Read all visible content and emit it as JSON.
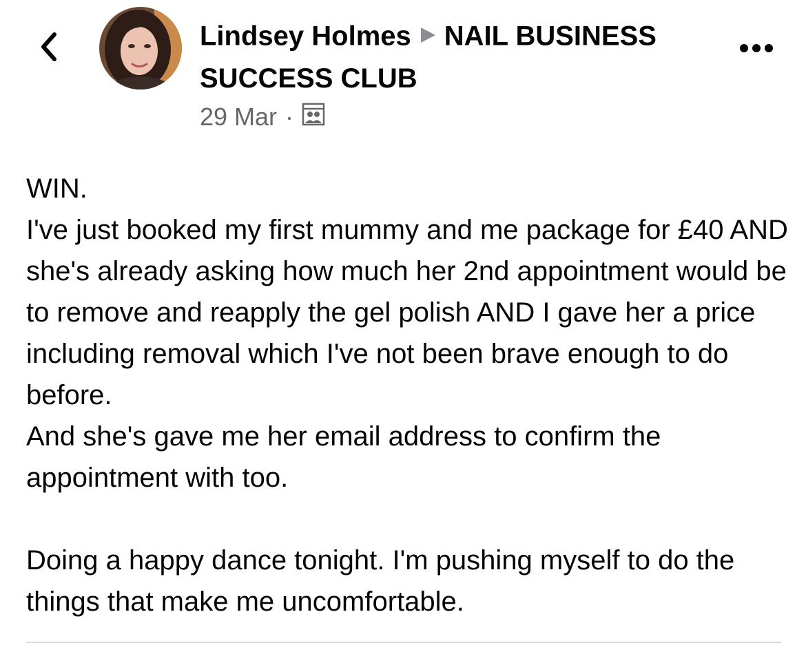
{
  "header": {
    "author_name": "Lindsey Holmes",
    "group_name": "NAIL BUSINESS SUCCESS CLUB",
    "date": "29 Mar",
    "separator": "·",
    "audience_icon": "group-audience-icon"
  },
  "nav": {
    "back_icon": "chevron-left-icon",
    "more_icon": "more-options-icon"
  },
  "post": {
    "text": "WIN.\nI've just booked my first mummy and me package for £40 AND she's already asking how much her 2nd appointment would be to remove and reapply the gel polish AND I gave her a price including removal which I've not been brave enough to do before.\nAnd she's gave me her email address to confirm the appointment with too.\n\nDoing a happy dance tonight. I'm pushing myself to do the things that make me uncomfortable."
  },
  "colors": {
    "text_primary": "#050505",
    "text_secondary": "#65676b",
    "arrow": "#8a8d91",
    "divider": "#d8dadf"
  }
}
